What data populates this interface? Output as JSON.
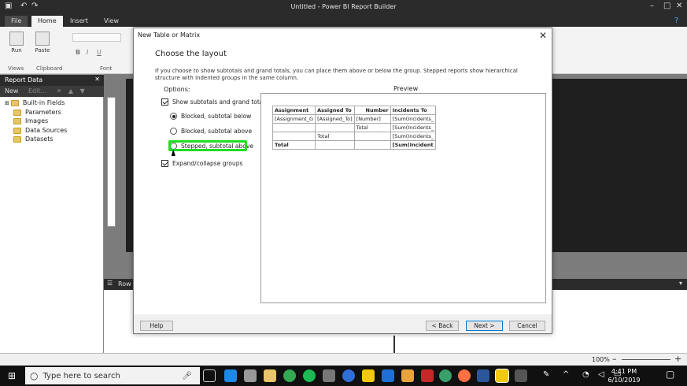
{
  "app": {
    "title": "Untitled - Power BI Report Builder"
  },
  "ribbon": {
    "tabs": [
      "File",
      "Home",
      "Insert",
      "View"
    ],
    "run_label": "Run",
    "paste_label": "Paste",
    "groups": [
      "Views",
      "Clipboard",
      "Font"
    ]
  },
  "report_data": {
    "title": "Report Data",
    "new_label": "New",
    "edit_label": "Edit...",
    "items": [
      "Built-in Fields",
      "Parameters",
      "Images",
      "Data Sources",
      "Datasets"
    ]
  },
  "grouping": {
    "label": "Row G"
  },
  "status": {
    "zoom": "100%"
  },
  "taskbar": {
    "search_placeholder": "Type here to search",
    "time": "4:41 PM",
    "date": "6/10/2019"
  },
  "dialog": {
    "title": "New Table or Matrix",
    "heading": "Choose the layout",
    "description": "If you choose to show subtotals and grand totals, you can place them above or below the group. Stepped reports show hierarchical structure with indented groups in the same column.",
    "options_label": "Options:",
    "preview_label": "Preview",
    "show_subtotals": "Show subtotals and grand totals",
    "blocked_below": "Blocked, subtotal below",
    "blocked_above": "Blocked, subtotal above",
    "stepped_above": "Stepped, subtotal above",
    "expand_collapse": "Expand/collapse groups",
    "preview_table": {
      "headers": [
        "Assignment",
        "Assigned To",
        "Number",
        "Incidents To"
      ],
      "rows": [
        [
          "[Assignment_G",
          "[Assigned_To]",
          "[Number]",
          "[Sum(Incidents_"
        ],
        [
          "",
          "",
          "Total",
          "[Sum(Incidents_"
        ],
        [
          "",
          "Total",
          "",
          "[Sum(Incidents_"
        ],
        [
          "Total",
          "",
          "",
          "[Sum(Incident"
        ]
      ]
    },
    "help_label": "Help",
    "back_label": "< Back",
    "next_label": "Next >",
    "cancel_label": "Cancel"
  }
}
